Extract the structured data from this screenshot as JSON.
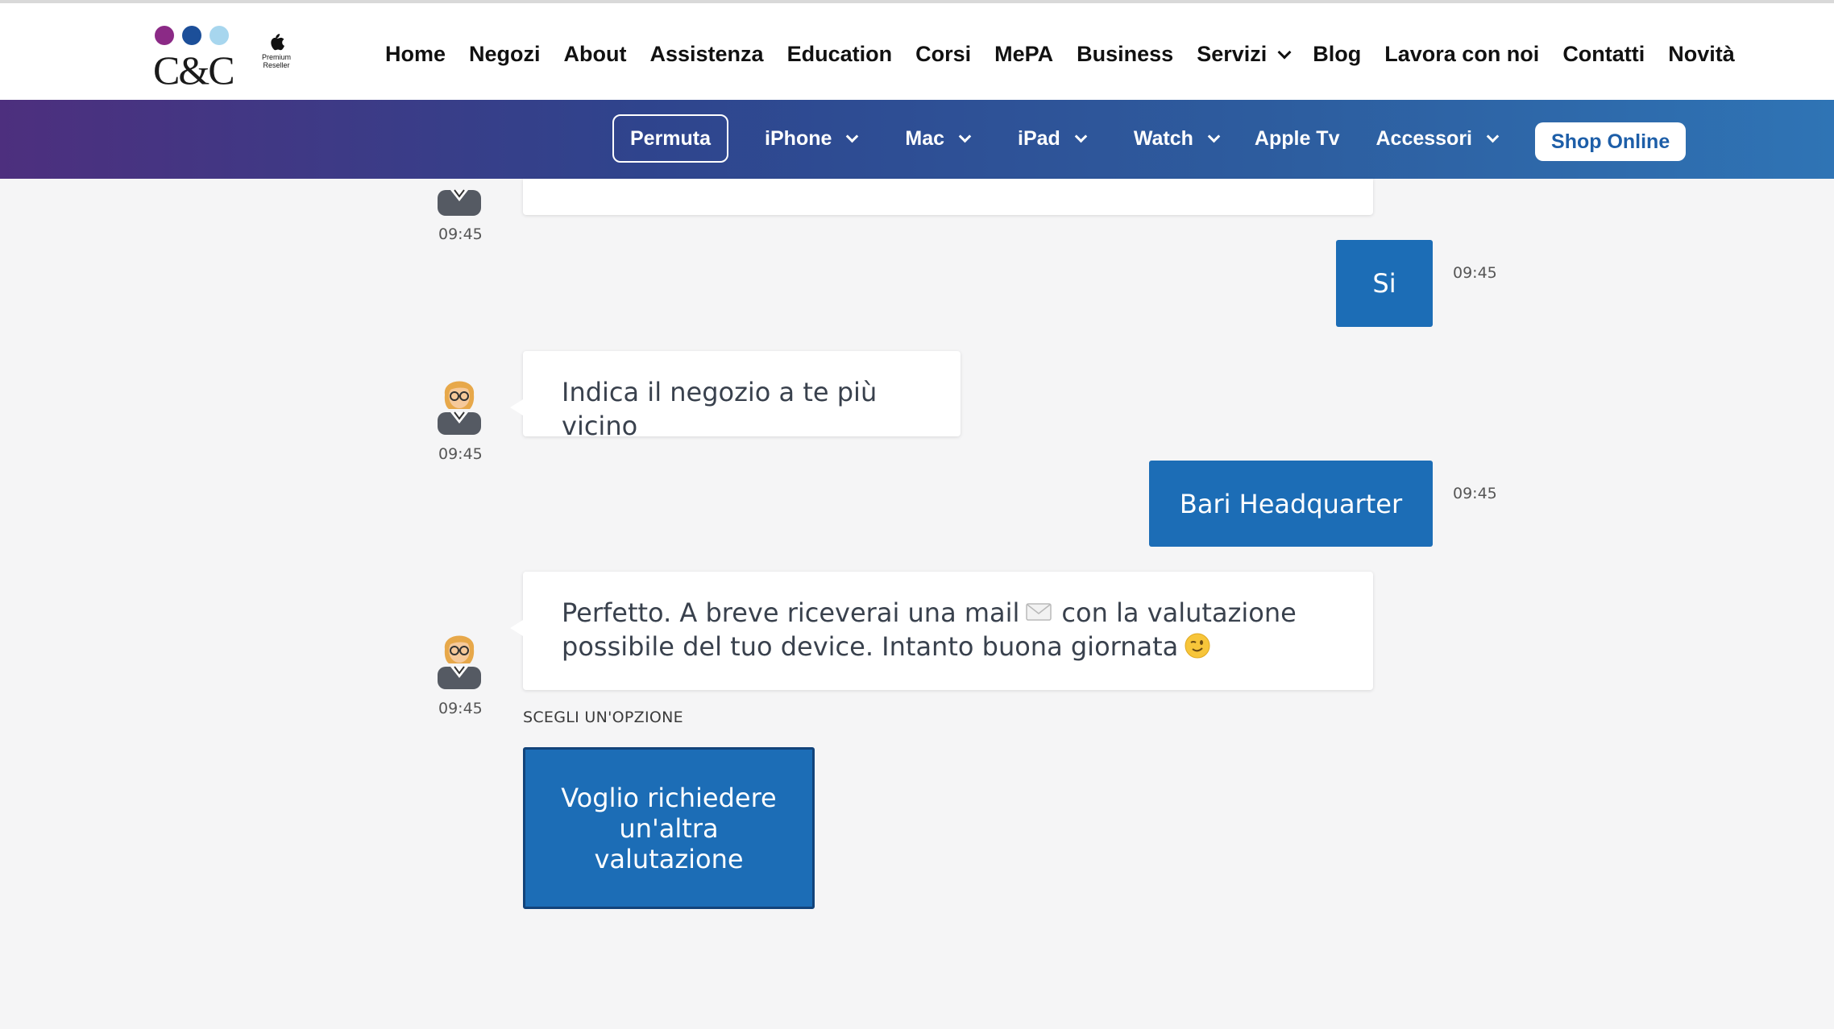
{
  "header": {
    "logo_text": "C&C",
    "apple_badge": "Premium Reseller",
    "nav": [
      "Home",
      "Negozi",
      "About",
      "Assistenza",
      "Education",
      "Corsi",
      "MePA",
      "Business",
      "Servizi",
      "Blog",
      "Lavora con noi",
      "Contatti",
      "Novità"
    ]
  },
  "subnav": {
    "permuta": "Permuta",
    "iphone": "iPhone",
    "mac": "Mac",
    "ipad": "iPad",
    "watch": "Watch",
    "appletv": "Apple Tv",
    "accessori": "Accessori",
    "shop": "Shop Online"
  },
  "chat": {
    "time": "09:45",
    "user_si": "Si",
    "bot_negozio": "Indica il negozio a te più vicino",
    "user_store": "Bari Headquarter",
    "bot_final_a": "Perfetto. A breve riceverai una mail",
    "bot_final_b": "con la valutazione",
    "bot_final_c": "possibile del tuo device. Intanto buona giornata",
    "options_label": "SCEGLI UN'OPZIONE",
    "option_button": "Voglio richiedere un'altra valutazione"
  },
  "colors": {
    "accent": "#1c6db6",
    "band_start": "#4d2f7e",
    "band_end": "#2f74b5",
    "page_bg": "#f5f5f6"
  },
  "icons": [
    "apple-icon",
    "envelope-icon",
    "wink-emoji-icon",
    "assistant-avatar"
  ]
}
